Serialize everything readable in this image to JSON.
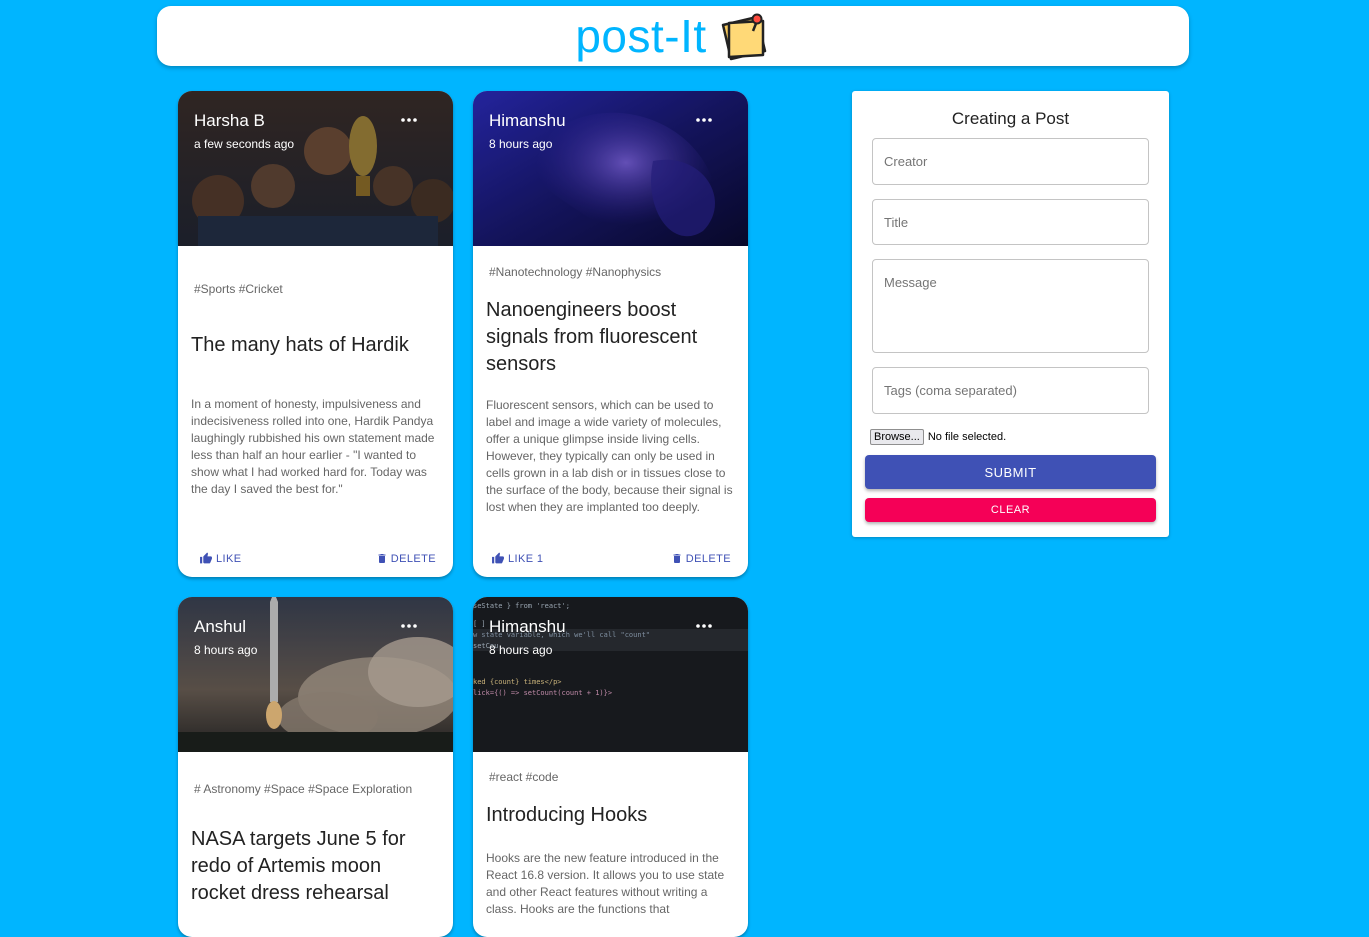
{
  "app": {
    "title": "post-It"
  },
  "posts": [
    {
      "creator": "Harsha B",
      "time": "a few seconds ago",
      "tags": "#Sports #Cricket",
      "title": "The many hats of Hardik",
      "message": "In a moment of honesty, impulsiveness and indecisiveness rolled into one, Hardik Pandya laughingly rubbished his own statement made less than half an hour earlier - \"I wanted to show what I had worked hard for. Today was the day I saved the best for.\"",
      "like_label": "LIKE",
      "delete_label": "DELETE"
    },
    {
      "creator": "Himanshu",
      "time": "8 hours ago",
      "tags": "#Nanotechnology #Nanophysics",
      "title": "Nanoengineers boost signals from fluorescent sensors",
      "message": "Fluorescent sensors, which can be used to label and image a wide variety of molecules, offer a unique glimpse inside living cells. However, they typically can only be used in cells grown in a lab dish or in tissues close to the surface of the body, because their signal is lost when they are implanted too deeply.",
      "like_label": "LIKE 1",
      "delete_label": "DELETE"
    },
    {
      "creator": "Anshul",
      "time": "8 hours ago",
      "tags": "# Astronomy #Space #Space Exploration",
      "title": "NASA targets June 5 for redo of Artemis moon rocket dress rehearsal"
    },
    {
      "creator": "Himanshu",
      "time": "8 hours ago",
      "tags": "#react #code",
      "title": "Introducing Hooks",
      "message": "Hooks are the new feature introduced in the React 16.8 version. It allows you to use state and other React features without writing a class. Hooks are the functions that",
      "code_lines": [
        "seState } from 'react';",
        "[ ]",
        "w state variable, which we'll call \"count\"",
        "setCou",
        "ked {count} times</p>",
        "lick={() => setCount(count + 1)}>"
      ]
    }
  ],
  "form": {
    "title": "Creating a Post",
    "creator_placeholder": "Creator",
    "title_placeholder": "Title",
    "message_placeholder": "Message",
    "tags_placeholder": "Tags (coma separated)",
    "browse_label": "Browse...",
    "file_status": "No file selected.",
    "submit_label": "SUBMIT",
    "clear_label": "CLEAR"
  },
  "colors": {
    "background": "#00b5ff",
    "primary": "#3f51b5",
    "secondary": "#f50057"
  }
}
